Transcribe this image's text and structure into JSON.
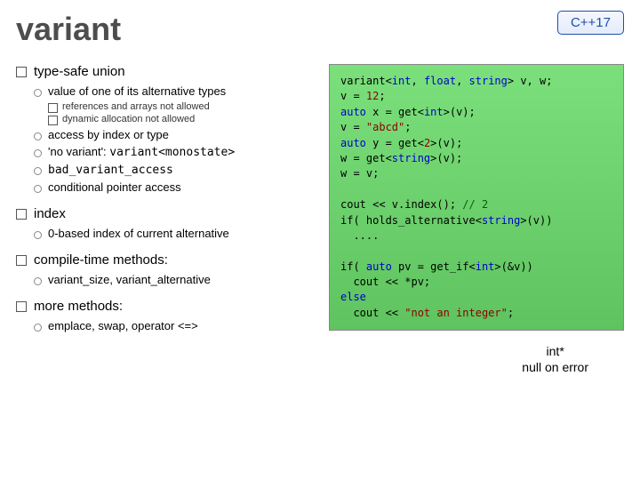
{
  "title": "variant",
  "badge": "C++17",
  "bullets": {
    "typesafe": {
      "heading": "type-safe union",
      "sub": [
        {
          "text": "value of one of its alternative types",
          "subsub": [
            "references and arrays not allowed",
            "dynamic allocation not allowed"
          ]
        },
        {
          "text": "access by index or type"
        },
        {
          "prefix": "'no variant': ",
          "code": "variant<monostate>"
        },
        {
          "code": "bad_variant_access"
        },
        {
          "text": "conditional pointer access"
        }
      ]
    },
    "index": {
      "heading": "index",
      "sub": [
        {
          "text": "0-based index of current alternative"
        }
      ]
    },
    "compile": {
      "heading": "compile-time methods:",
      "sub": [
        {
          "text": "variant_size, variant_alternative"
        }
      ]
    },
    "more": {
      "heading": "more methods:",
      "sub": [
        {
          "text": "emplace, swap, operator <=>"
        }
      ]
    }
  },
  "code": {
    "l01a": "variant<",
    "l01b": "int",
    "l01c": ", ",
    "l01d": "float",
    "l01e": ", ",
    "l01f": "string",
    "l01g": "> v, w;",
    "l02a": "v = ",
    "l02b": "12",
    "l02c": "; ",
    "l03a": "auto",
    "l03b": " x = get<",
    "l03c": "int",
    "l03d": ">(v);",
    "l04a": "v = ",
    "l04b": "\"abcd\"",
    "l04c": ";",
    "l05a": "auto",
    "l05b": " y = get<",
    "l05c": "2",
    "l05d": ">(v);",
    "l06a": "w = get<",
    "l06b": "string",
    "l06c": ">(v);",
    "l07": "w = v;",
    "l09a": "cout << v.index(); ",
    "l09b": "// 2",
    "l10a": "if( holds_alternative<",
    "l10b": "string",
    "l10c": ">(v))",
    "l11": "  ....",
    "l13a": "if( ",
    "l13b": "auto",
    "l13c": " pv = get_if<",
    "l13d": "int",
    "l13e": ">(&v))",
    "l14": "  cout << *pv;",
    "l15a": "else",
    "l16a": "  cout << ",
    "l16b": "\"not an integer\"",
    "l16c": ";"
  },
  "note": {
    "line1": "int*",
    "line2": "null on error"
  },
  "chart_data": {
    "type": "table",
    "title": "variant — C++17 slide",
    "sections": [
      {
        "name": "type-safe union",
        "points": [
          "value of one of its alternative types",
          "references and arrays not allowed",
          "dynamic allocation not allowed",
          "access by index or type",
          "'no variant': variant<monostate>",
          "bad_variant_access",
          "conditional pointer access"
        ]
      },
      {
        "name": "index",
        "points": [
          "0-based index of current alternative"
        ]
      },
      {
        "name": "compile-time methods:",
        "points": [
          "variant_size, variant_alternative"
        ]
      },
      {
        "name": "more methods:",
        "points": [
          "emplace, swap, operator <=>"
        ]
      }
    ],
    "code_sample": "variant<int, float, string> v, w;\nv = 12;\nauto x = get<int>(v);\nv = \"abcd\";\nauto y = get<2>(v);\nw = get<string>(v);\nw = v;\n\ncout << v.index(); // 2\nif( holds_alternative<string>(v))\n  ....\n\nif( auto pv = get_if<int>(&v))\n  cout << *pv;\nelse\n  cout << \"not an integer\";",
    "annotation": "int* — null on error"
  }
}
